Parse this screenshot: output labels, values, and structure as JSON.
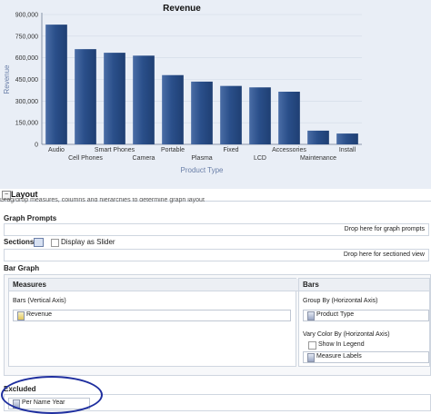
{
  "chart_data": {
    "type": "bar",
    "title": "Revenue",
    "xlabel": "Product Type",
    "ylabel": "Revenue",
    "categories": [
      "Audio",
      "Cell Phones",
      "Smart Phones",
      "Camera",
      "Portable",
      "Plasma",
      "Fixed",
      "LCD",
      "Accessories",
      "Maintenance",
      "Install"
    ],
    "values": [
      830000,
      660000,
      635000,
      615000,
      480000,
      435000,
      405000,
      395000,
      365000,
      95000,
      75000
    ],
    "yticks": [
      "0",
      "150,000",
      "300,000",
      "450,000",
      "600,000",
      "750,000",
      "900,000"
    ],
    "ylim": [
      0,
      900000
    ],
    "bar_color": "#1f3f73"
  },
  "layout": {
    "title": "Layout",
    "hint": "Drag/drop measures, columns and hierarchies to determine graph layout"
  },
  "graph_prompts": {
    "title": "Graph Prompts",
    "drop_text": "Drop here for graph prompts"
  },
  "sections": {
    "title": "Sections",
    "slider_label": "Display as Slider",
    "drop_text": "Drop here for sectioned view"
  },
  "bar_graph": {
    "title": "Bar Graph",
    "measures": {
      "title": "Measures",
      "axis_label": "Bars (Vertical Axis)",
      "item": "Revenue"
    },
    "bars": {
      "title": "Bars",
      "group_by_label": "Group By (Horizontal Axis)",
      "group_by_item": "Product Type",
      "vary_color_label": "Vary Color By (Horizontal Axis)",
      "show_in_legend": "Show In Legend",
      "vary_item": "Measure Labels"
    }
  },
  "excluded": {
    "title": "Excluded",
    "item": "Per Name Year"
  }
}
